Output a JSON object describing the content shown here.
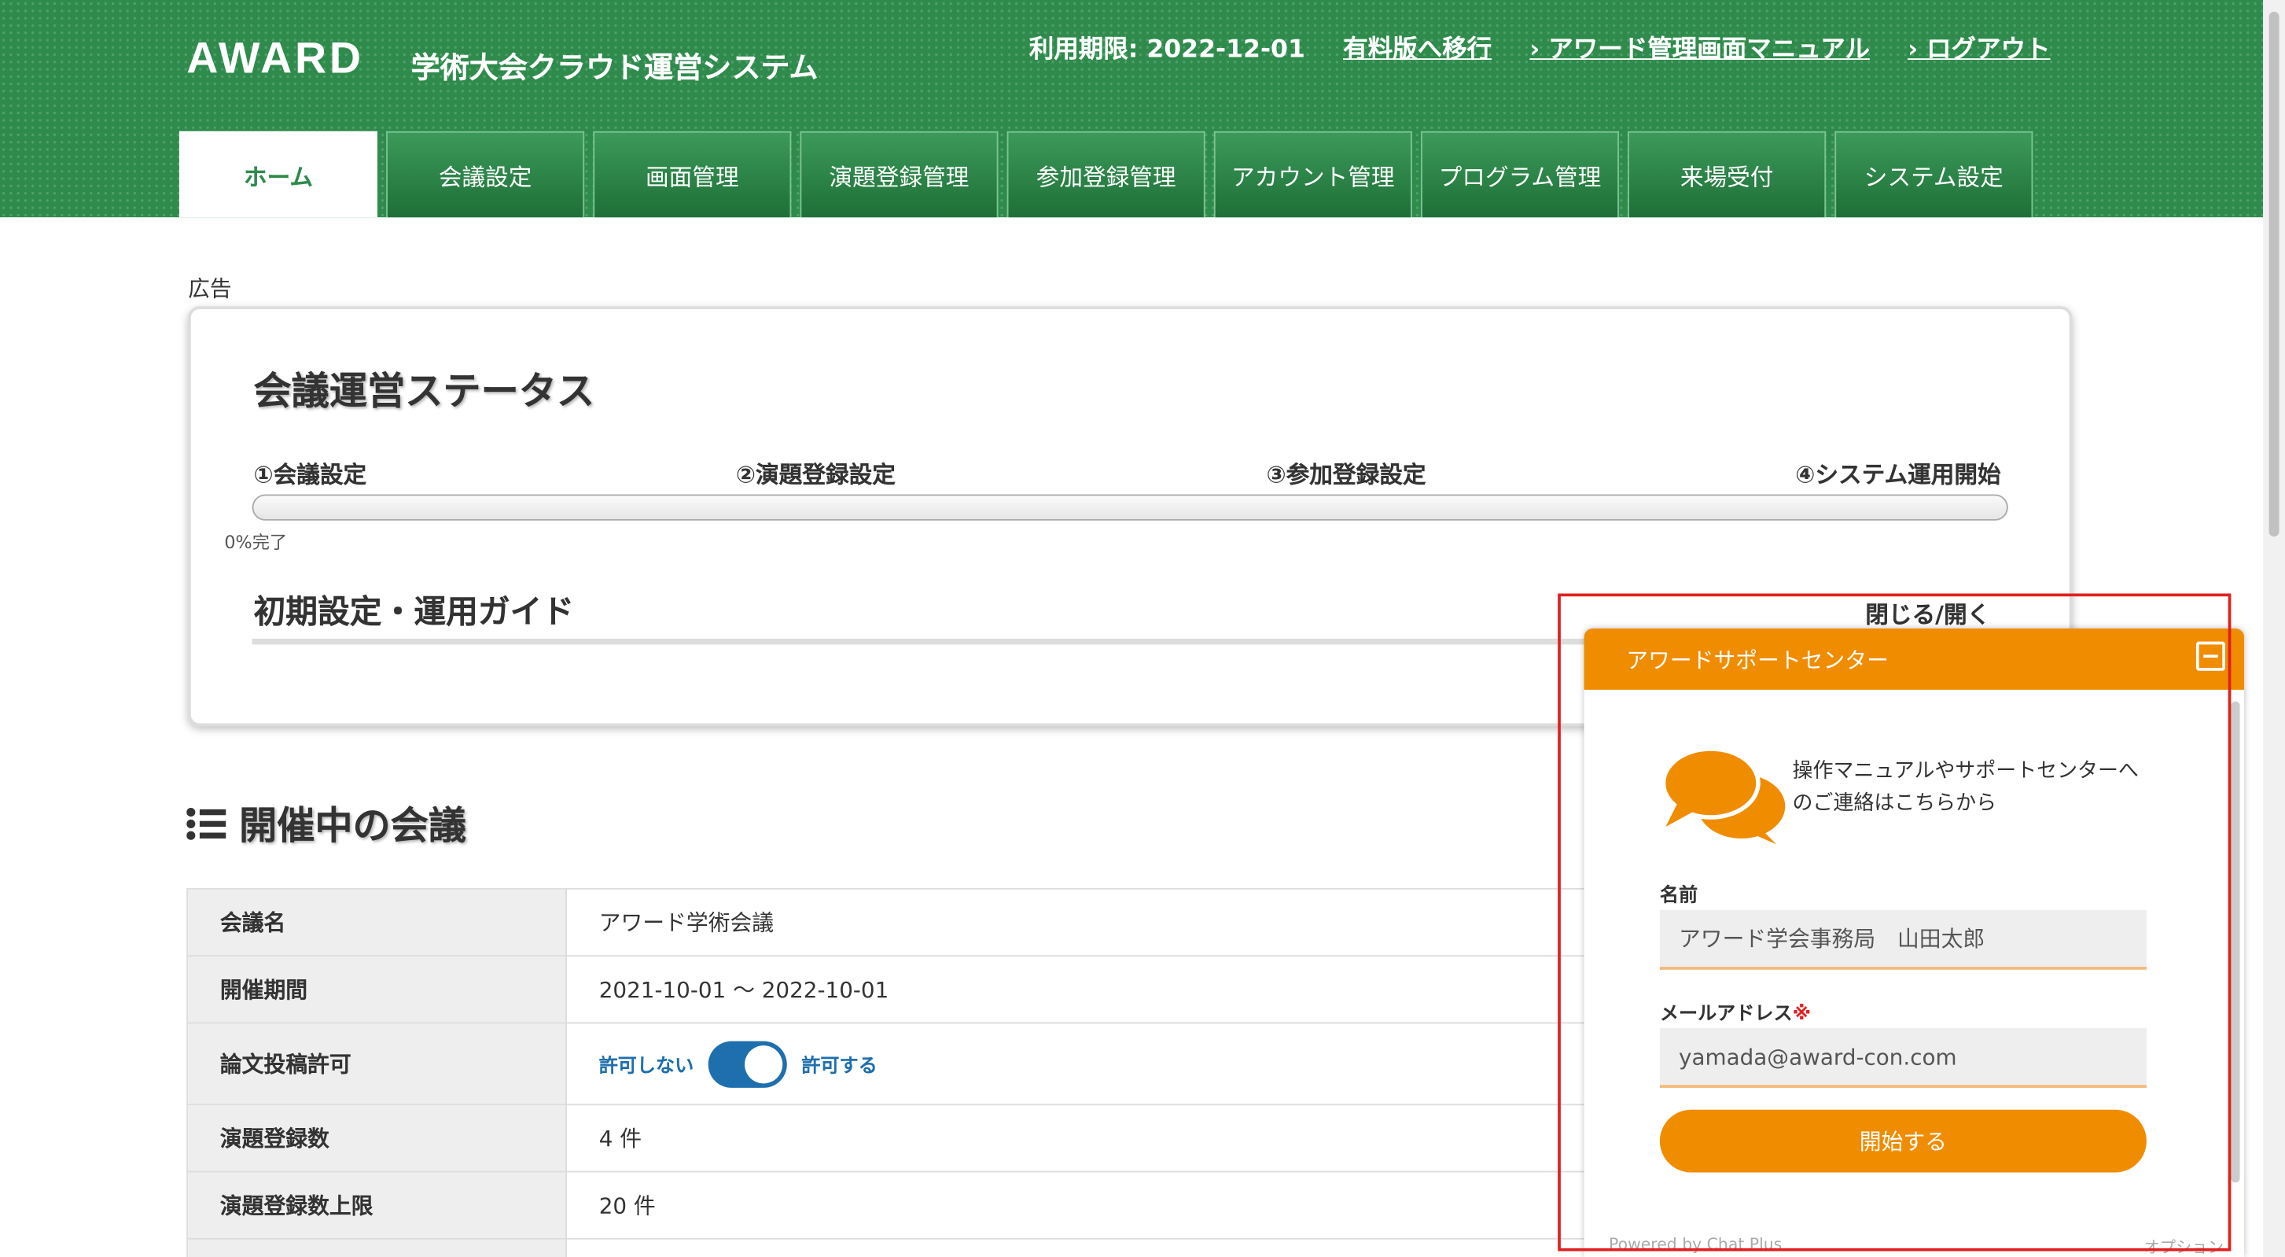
{
  "header": {
    "logo": "AWARD",
    "system_name": "学術大会クラウド運営システム",
    "limit": "利用期限: 2022-12-01",
    "links": [
      "有料版へ移行",
      "› アワード管理画面マニュアル",
      "› ログアウト"
    ]
  },
  "tabs": [
    "ホーム",
    "会議設定",
    "画面管理",
    "演題登録管理",
    "参加登録管理",
    "アカウント管理",
    "プログラム管理",
    "来場受付",
    "システム設定"
  ],
  "ad_label": "広告",
  "status": {
    "title": "会議運営ステータス",
    "steps": [
      "①会議設定",
      "②演題登録設定",
      "③参加登録設定",
      "④システム運用開始"
    ],
    "progress": 0,
    "progress_text": "0%完了",
    "guide_title": "初期設定・運用ガイド",
    "toggle": "閉じる/開く"
  },
  "section": {
    "title": "開催中の会議"
  },
  "conf_table": [
    {
      "label": "会議名",
      "value": "アワード学術会議"
    },
    {
      "label": "開催期間",
      "value": "2021-10-01 〜 2022-10-01"
    },
    {
      "label": "論文投稿許可",
      "off": "許可しない",
      "on": "許可する"
    },
    {
      "label": "演題登録数",
      "value": "4 件"
    },
    {
      "label": "演題登録数上限",
      "value": "20 件"
    }
  ],
  "chat": {
    "title": "アワードサポートセンター",
    "intro1": "操作マニュアルやサポートセンターへ",
    "intro2": "のご連絡はこちらから",
    "name_label": "名前",
    "name_value": "アワード学会事務局　山田太郎",
    "email_label": "メールアドレス",
    "required_mark": "※",
    "email_value": "yamada@award-con.com",
    "start": "開始する",
    "powered": "Powered by Chat Plus",
    "option": "オプション"
  },
  "colors": {
    "header_green": "#2e8b4c",
    "chat_orange": "#f08c00",
    "switch_blue": "#1e6fae",
    "highlight_red": "#e02020"
  }
}
